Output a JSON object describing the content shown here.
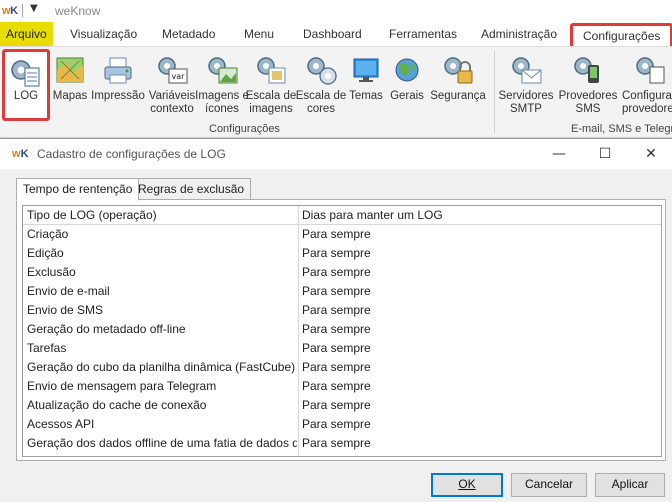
{
  "app": {
    "logo_w": "w",
    "logo_k": "K",
    "title": "weKnow",
    "colors": {
      "arquivo_tab": "#e8dd00",
      "highlight": "#e03b3b",
      "primary_button_border": "#0078d7"
    }
  },
  "menu": {
    "tabs": [
      "Arquivo",
      "Visualização",
      "Metadado",
      "Menu",
      "Dashboard",
      "Ferramentas",
      "Administração",
      "Configurações"
    ]
  },
  "ribbon": {
    "groups": [
      {
        "label": "Configurações"
      },
      {
        "label": "E-mail, SMS e Telegr"
      }
    ],
    "buttons": [
      {
        "label": "LOG",
        "icon": "log-gear-icon"
      },
      {
        "label": "Mapas",
        "icon": "map-icon"
      },
      {
        "label": "Impressão",
        "icon": "printer-icon"
      },
      {
        "label": "Variáveis contexto",
        "icon": "variables-icon",
        "badge": "var"
      },
      {
        "label": "Imagens e ícones",
        "icon": "images-icon"
      },
      {
        "label": "Escala de imagens",
        "icon": "image-scale-icon"
      },
      {
        "label": "Escala de cores",
        "icon": "color-scale-icon"
      },
      {
        "label": "Temas",
        "icon": "themes-icon"
      },
      {
        "label": "Gerais",
        "icon": "general-icon"
      },
      {
        "label": "Segurança",
        "icon": "security-lock-icon"
      },
      {
        "label": "Servidores SMTP",
        "icon": "smtp-mail-icon"
      },
      {
        "label": "Provedores SMS",
        "icon": "sms-provider-icon"
      },
      {
        "label": "Configura provedore",
        "icon": "provider-config-icon"
      }
    ]
  },
  "dialog": {
    "title": "Cadastro de configurações de LOG",
    "tabs": [
      "Tempo de rentenção",
      "Regras de exclusão"
    ],
    "table": {
      "headers": [
        "Tipo de LOG (operação)",
        "Dias para manter um LOG"
      ],
      "rows": [
        [
          "Criação",
          "Para sempre"
        ],
        [
          "Edição",
          "Para sempre"
        ],
        [
          "Exclusão",
          "Para sempre"
        ],
        [
          "Envio de e-mail",
          "Para sempre"
        ],
        [
          "Envio de SMS",
          "Para sempre"
        ],
        [
          "Geração do metadado off-line",
          "Para sempre"
        ],
        [
          "Tarefas",
          "Para sempre"
        ],
        [
          "Geração do cubo da planilha dinâmica (FastCube)",
          "Para sempre"
        ],
        [
          "Envio de mensagem para Telegram",
          "Para sempre"
        ],
        [
          "Atualização do cache de conexão",
          "Para sempre"
        ],
        [
          "Acessos API",
          "Para sempre"
        ],
        [
          "Geração dos dados offline de uma fatia de dados de",
          "Para sempre"
        ]
      ]
    },
    "buttons": {
      "ok": "OK",
      "cancel": "Cancelar",
      "apply": "Aplicar"
    }
  }
}
